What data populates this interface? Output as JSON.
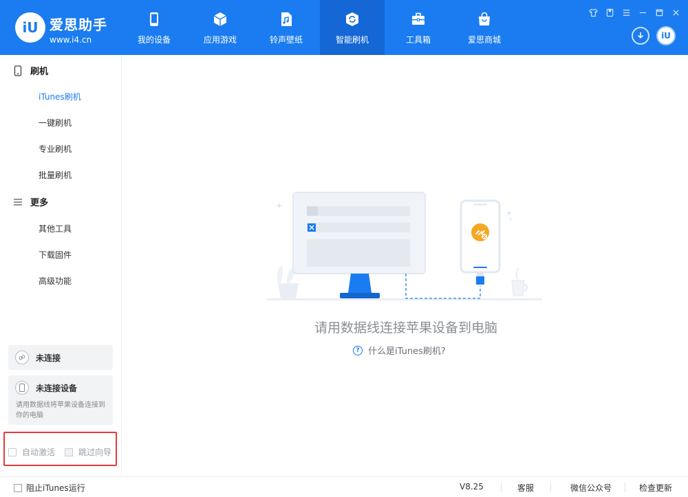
{
  "app": {
    "name": "爱思助手",
    "url": "www.i4.cn",
    "logo_text": "iU",
    "avatar_text": "iU"
  },
  "nav": [
    {
      "label": "我的设备",
      "icon": "phone-icon"
    },
    {
      "label": "应用游戏",
      "icon": "cube-icon"
    },
    {
      "label": "铃声壁纸",
      "icon": "music-file-icon"
    },
    {
      "label": "智能刷机",
      "icon": "refresh-shield-icon"
    },
    {
      "label": "工具箱",
      "icon": "toolbox-icon"
    },
    {
      "label": "爱思商城",
      "icon": "shopping-bag-icon"
    }
  ],
  "window_controls": [
    "shirt-icon",
    "card-icon",
    "menu-icon",
    "minimize-icon",
    "maximize-icon",
    "close-icon"
  ],
  "sidebar": {
    "section_flash": "刷机",
    "flash_items": [
      "iTunes刷机",
      "一键刷机",
      "专业刷机",
      "批量刷机"
    ],
    "section_more": "更多",
    "more_items": [
      "其他工具",
      "下载固件",
      "高级功能"
    ],
    "status_connection": "未连接",
    "status_device": "未连接设备",
    "status_device_desc": "请用数据线将苹果设备连接到你的电脑",
    "auto_activate": "自动激活",
    "skip_guide": "跳过向导"
  },
  "main": {
    "message": "请用数据线连接苹果设备到电脑",
    "help_link": "什么是iTunes刷机?"
  },
  "footer": {
    "block_itunes": "阻止iTunes运行",
    "version": "V8.25",
    "support": "客服",
    "wechat": "微信公众号",
    "check_update": "检查更新"
  },
  "colors": {
    "primary": "#1a7cf0",
    "active_nav": "#1567d6",
    "highlight_frame": "#e23b3b"
  }
}
